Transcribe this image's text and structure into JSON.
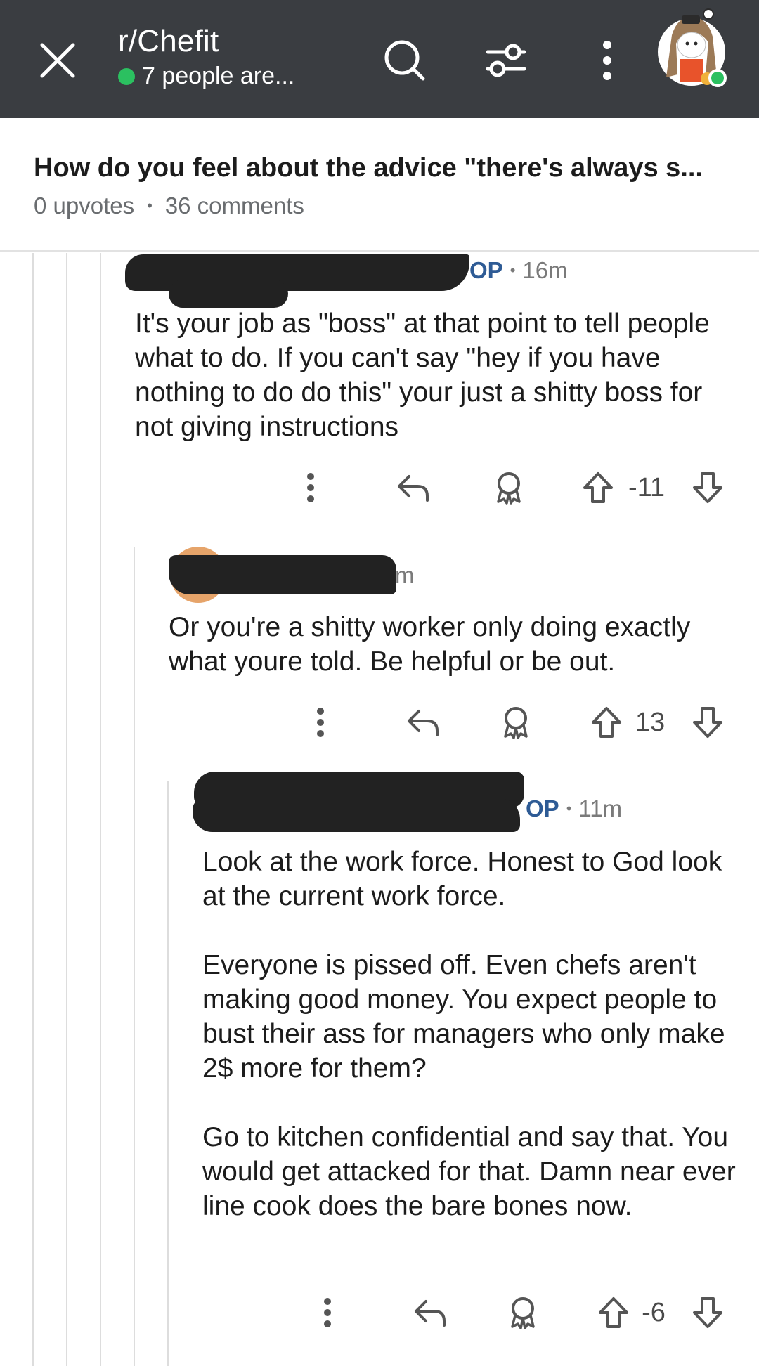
{
  "app": {
    "subreddit": "r/Chefit",
    "presence": "7 people are...",
    "colors": {
      "bar": "#3a3d41",
      "online": "#2bc060",
      "op": "#2e5b95"
    }
  },
  "post": {
    "title": "How do you feel about the advice \"there's always s...",
    "upvotes": "0 upvotes",
    "separator": "•",
    "comments": "36 comments"
  },
  "comments": [
    {
      "op_badge": "OP",
      "sep": "•",
      "time": "16m",
      "paragraphs": [
        "It's your job as \"boss\" at that point to tell people what to do. If you can't say \"hey if you have nothing to do do this\" your just a shitty boss for not giving instructions"
      ],
      "score": "-11"
    },
    {
      "time_partial": "m",
      "paragraphs": [
        "Or you're a shitty worker only doing exactly what youre told. Be helpful or be out."
      ],
      "score": "13"
    },
    {
      "op_badge": "OP",
      "sep": "•",
      "time": "11m",
      "paragraphs": [
        "Look at the work force. Honest to God look at the current work force.",
        "Everyone is pissed off. Even chefs aren't making good money. You expect people to bust their ass for managers who only make 2$ more for them?",
        "Go to kitchen confidential and say that. You would get attacked for that. Damn near ever line cook does the bare bones now."
      ],
      "score": "-6"
    }
  ],
  "icons": [
    "close-icon",
    "search-icon",
    "filter-icon",
    "more-vertical-icon",
    "reply-icon",
    "award-icon",
    "upvote-icon",
    "downvote-icon"
  ]
}
